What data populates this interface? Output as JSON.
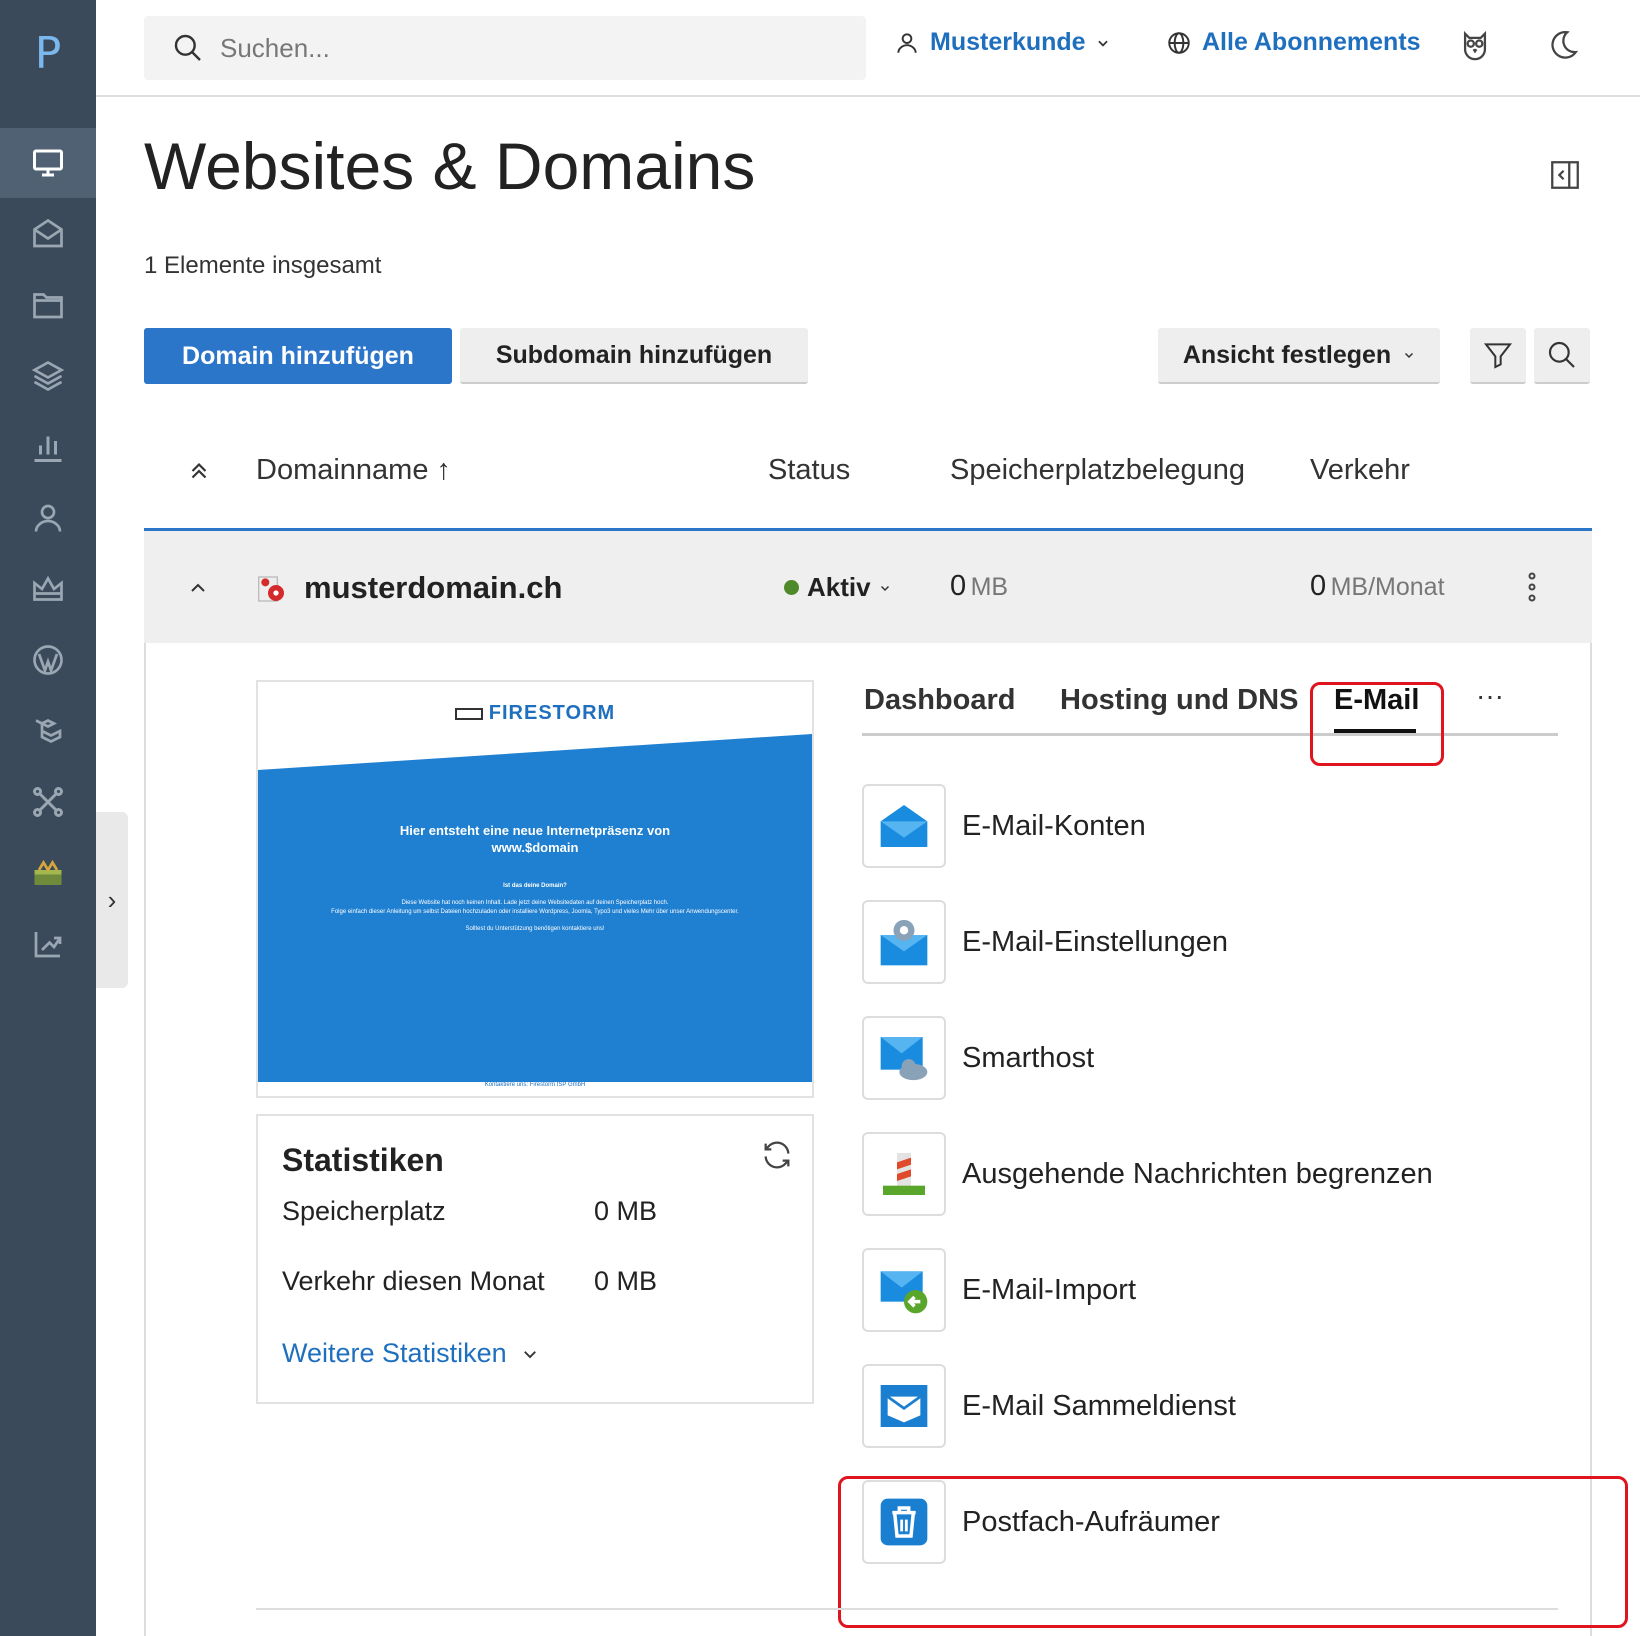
{
  "sidebar": {
    "logo": "P",
    "items": [
      {
        "icon": "monitor-icon",
        "active": true
      },
      {
        "icon": "mail-icon"
      },
      {
        "icon": "folder-icon"
      },
      {
        "icon": "layers-icon"
      },
      {
        "icon": "bar-chart-icon"
      },
      {
        "icon": "user-icon"
      },
      {
        "icon": "crown-icon"
      },
      {
        "icon": "wordpress-icon"
      },
      {
        "icon": "laravel-icon"
      },
      {
        "icon": "joomla-icon"
      },
      {
        "icon": "toolbox-icon"
      },
      {
        "icon": "chart-export-icon"
      }
    ],
    "expand_glyph": "›"
  },
  "topbar": {
    "search_placeholder": "Suchen...",
    "customer": "Musterkunde",
    "subscriptions": "Alle Abonnements"
  },
  "page": {
    "title": "Websites & Domains",
    "count": "1 Elemente insgesamt"
  },
  "buttons": {
    "add_domain": "Domain hinzufügen",
    "add_subdomain": "Subdomain hinzufügen",
    "set_view": "Ansicht festlegen"
  },
  "table": {
    "headers": {
      "domain": "Domainname ↑",
      "status": "Status",
      "storage": "Speicherplatzbelegung",
      "traffic": "Verkehr"
    }
  },
  "domain": {
    "name": "musterdomain.ch",
    "status": "Aktiv",
    "storage_value": "0",
    "storage_unit": "MB",
    "traffic_value": "0",
    "traffic_unit": "MB/Monat",
    "status_color": "#4f8a2a"
  },
  "preview": {
    "logo": "FIRESTORM",
    "headline_1": "Hier entsteht eine neue Internetpräsenz von",
    "headline_2": "www.$domain",
    "question": "Ist das deine Domain?",
    "body_1": "Diese Website hat noch keinen Inhalt. Lade jetzt deine Websitedaten auf deinen Speicherplatz hoch.",
    "body_2": "Folge einfach dieser Anleitung um selbst Dateien hochzuladen oder installiere Wordpress, Joomla, Typo3 und vieles Mehr über unser Anwendungscenter.",
    "body_3": "Solltest du Unterstützung benötigen kontaktiere uns!",
    "footer": "Kontaktiere uns: Firestorm ISP GmbH",
    "accent": "#1f7fd0"
  },
  "stats": {
    "title": "Statistiken",
    "storage_label": "Speicherplatz",
    "storage_value": "0 MB",
    "traffic_label": "Verkehr diesen Monat",
    "traffic_value": "0 MB",
    "more": "Weitere Statistiken"
  },
  "tabs": {
    "dashboard": "Dashboard",
    "hosting": "Hosting und DNS",
    "email": "E-Mail",
    "more": "···"
  },
  "mail_items": [
    {
      "label": "E-Mail-Konten",
      "icon": "envelope-open-icon"
    },
    {
      "label": "E-Mail-Einstellungen",
      "icon": "envelope-gear-icon"
    },
    {
      "label": "Smarthost",
      "icon": "envelope-cloud-icon"
    },
    {
      "label": "Ausgehende Nachrichten begrenzen",
      "icon": "bollard-icon"
    },
    {
      "label": "E-Mail-Import",
      "icon": "envelope-import-icon"
    },
    {
      "label": "E-Mail Sammeldienst",
      "icon": "envelope-collect-icon"
    },
    {
      "label": "Postfach-Aufräumer",
      "icon": "trash-icon"
    }
  ],
  "colors": {
    "sidebar_bg": "#3b4a5a",
    "primary": "#2b76c9",
    "highlight": "#e0141e"
  }
}
